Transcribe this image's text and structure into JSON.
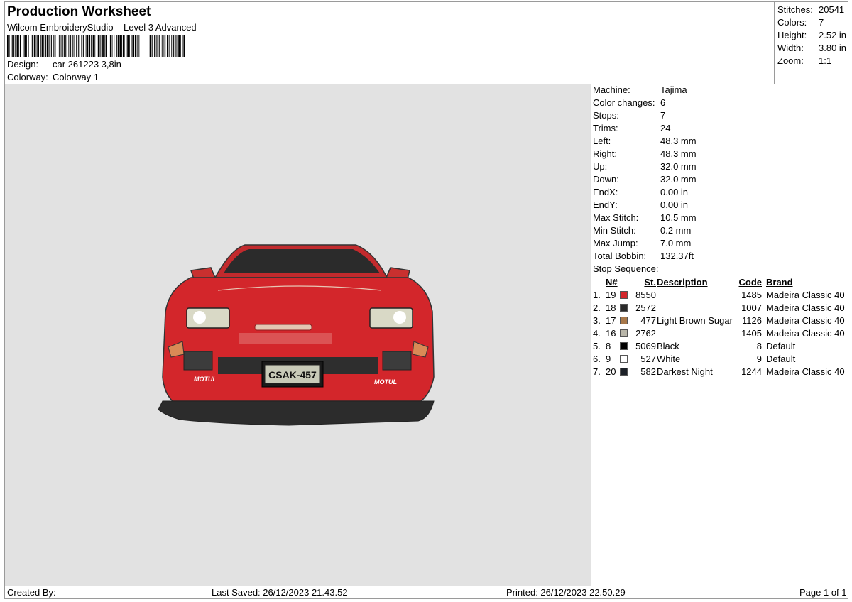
{
  "header": {
    "title": "Production Worksheet",
    "subtitle": "Wilcom EmbroideryStudio – Level 3 Advanced",
    "design_label": "Design:",
    "design_value": "car 261223 3,8in",
    "colorway_label": "Colorway:",
    "colorway_value": "Colorway 1"
  },
  "stats": [
    {
      "label": "Stitches:",
      "value": "20541"
    },
    {
      "label": "Colors:",
      "value": "7"
    },
    {
      "label": "Height:",
      "value": "2.52 in"
    },
    {
      "label": "Width:",
      "value": "3.80 in"
    },
    {
      "label": "Zoom:",
      "value": "1:1"
    }
  ],
  "machine_info": [
    {
      "label": "Machine:",
      "value": "Tajima"
    },
    {
      "label": "Color changes:",
      "value": "6"
    },
    {
      "label": "Stops:",
      "value": "7"
    },
    {
      "label": "Trims:",
      "value": "24"
    },
    {
      "label": "Left:",
      "value": "48.3 mm"
    },
    {
      "label": "Right:",
      "value": "48.3 mm"
    },
    {
      "label": "Up:",
      "value": "32.0 mm"
    },
    {
      "label": "Down:",
      "value": "32.0 mm"
    },
    {
      "label": "EndX:",
      "value": "0.00 in"
    },
    {
      "label": "EndY:",
      "value": "0.00 in"
    },
    {
      "label": "Max Stitch:",
      "value": "10.5 mm"
    },
    {
      "label": "Min Stitch:",
      "value": "0.2 mm"
    },
    {
      "label": "Max Jump:",
      "value": "7.0 mm"
    },
    {
      "label": "Total Bobbin:",
      "value": "132.37ft"
    }
  ],
  "stop_sequence": {
    "title": "Stop Sequence:",
    "columns": {
      "n": "N#",
      "st": "St.",
      "description": "Description",
      "code": "Code",
      "brand": "Brand"
    },
    "rows": [
      {
        "index": "1.",
        "n": "19",
        "color": "#d3262b",
        "st": "8550",
        "description": "",
        "code": "1485",
        "brand": "Madeira Classic 40"
      },
      {
        "index": "2.",
        "n": "18",
        "color": "#2a2a2a",
        "st": "2572",
        "description": "",
        "code": "1007",
        "brand": "Madeira Classic 40"
      },
      {
        "index": "3.",
        "n": "17",
        "color": "#a8784a",
        "st": "477",
        "description": "Light Brown Sugar",
        "code": "1126",
        "brand": "Madeira Classic 40"
      },
      {
        "index": "4.",
        "n": "16",
        "color": "#b9b6a9",
        "st": "2762",
        "description": "",
        "code": "1405",
        "brand": "Madeira Classic 40"
      },
      {
        "index": "5.",
        "n": "8",
        "color": "#000000",
        "st": "5069",
        "description": "Black",
        "code": "8",
        "brand": "Default"
      },
      {
        "index": "6.",
        "n": "9",
        "color": "#ffffff",
        "st": "527",
        "description": "White",
        "code": "9",
        "brand": "Default"
      },
      {
        "index": "7.",
        "n": "20",
        "color": "#1c2128",
        "st": "582",
        "description": "Darkest Night",
        "code": "1244",
        "brand": "Madeira Classic 40"
      }
    ]
  },
  "footer": {
    "created_by": "Created By:",
    "last_saved": "Last Saved: 26/12/2023 21.43.52",
    "printed": "Printed: 26/12/2023 22.50.29",
    "page": "Page 1 of 1"
  },
  "design_preview": {
    "plate_text": "CSAK-457",
    "badge_left": "MOTUL",
    "badge_right": "MOTUL",
    "background": "#e2e2e2",
    "body_color": "#d3262b"
  }
}
